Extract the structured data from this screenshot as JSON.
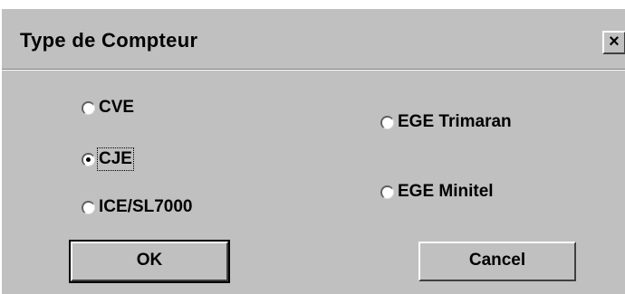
{
  "dialog": {
    "title": "Type de Compteur",
    "close_label": "✕"
  },
  "options_left": [
    {
      "label": "CVE",
      "selected": false
    },
    {
      "label": "CJE",
      "selected": true
    },
    {
      "label": "ICE/SL7000",
      "selected": false
    }
  ],
  "options_right": [
    {
      "label": "EGE Trimaran",
      "selected": false
    },
    {
      "label": "EGE Minitel",
      "selected": false
    }
  ],
  "buttons": {
    "ok": "OK",
    "cancel": "Cancel"
  }
}
